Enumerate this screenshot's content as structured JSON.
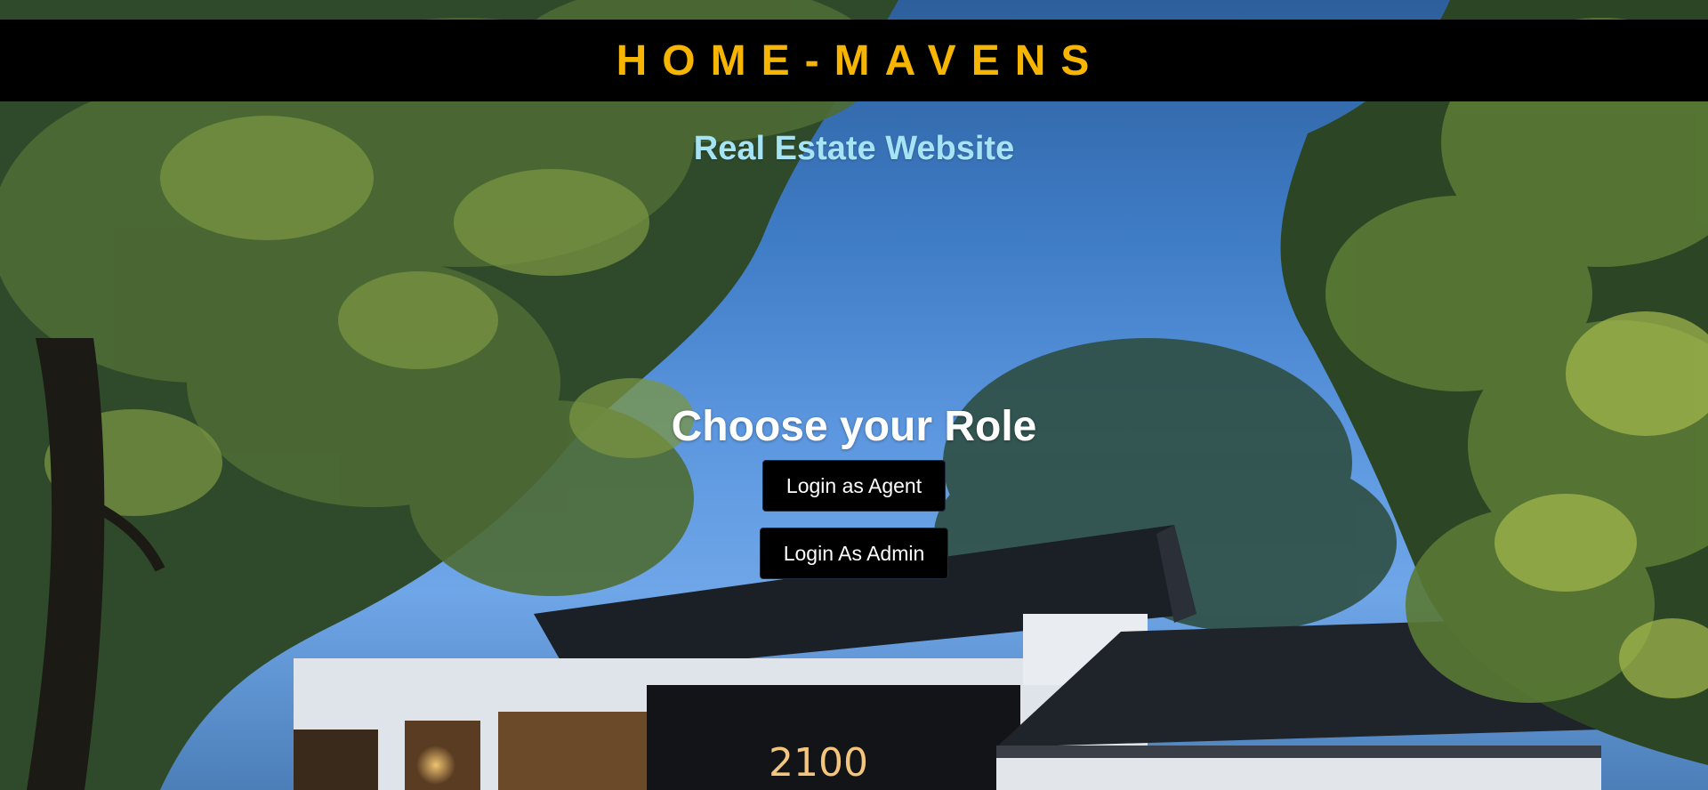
{
  "header": {
    "brand": "HOME-MAVENS"
  },
  "hero": {
    "subtitle": "Real Estate Website"
  },
  "role_selection": {
    "title": "Choose your Role",
    "agent_button_label": "Login as Agent",
    "admin_button_label": "Login As Admin"
  },
  "background": {
    "house_sign": "2100"
  },
  "colors": {
    "brand": "#f7b500",
    "subtitle": "#a6e4f5",
    "header_bg": "#000000",
    "button_bg": "#000000",
    "sky": "#5c97df"
  }
}
